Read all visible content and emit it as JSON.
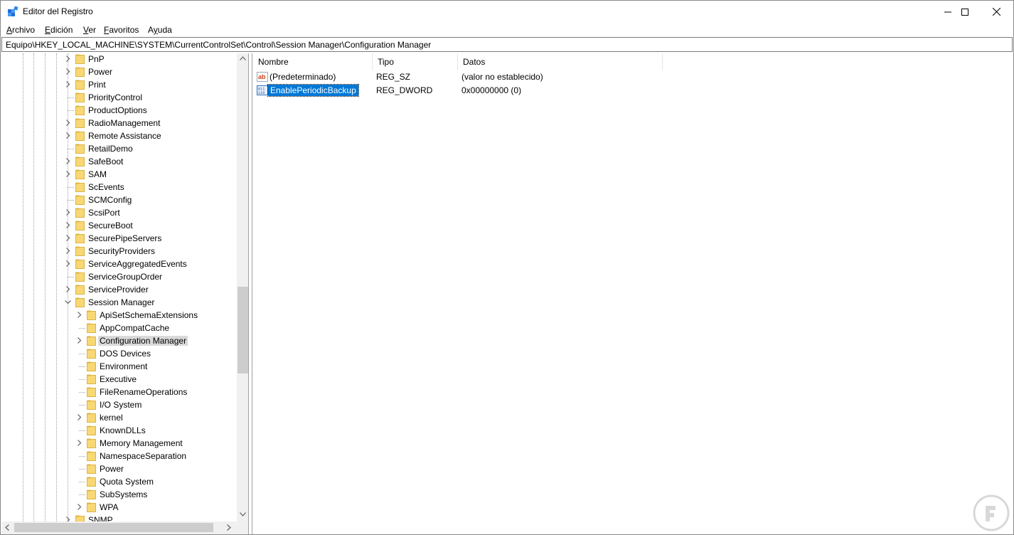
{
  "window": {
    "title": "Editor del Registro",
    "controls": {
      "minimize": "minimize-icon",
      "maximize": "maximize-icon",
      "close": "close-icon"
    }
  },
  "menu": [
    {
      "label": "Archivo",
      "key": "A"
    },
    {
      "label": "Edición",
      "key": "E"
    },
    {
      "label": "Ver",
      "key": "V"
    },
    {
      "label": "Favoritos",
      "key": "F"
    },
    {
      "label": "Ayuda",
      "key": "y"
    }
  ],
  "address": "Equipo\\HKEY_LOCAL_MACHINE\\SYSTEM\\CurrentControlSet\\Control\\Session Manager\\Configuration Manager",
  "tree": {
    "items": [
      {
        "label": "PnP",
        "level": 1,
        "expandable": true
      },
      {
        "label": "Power",
        "level": 1,
        "expandable": true
      },
      {
        "label": "Print",
        "level": 1,
        "expandable": true
      },
      {
        "label": "PriorityControl",
        "level": 1,
        "expandable": false
      },
      {
        "label": "ProductOptions",
        "level": 1,
        "expandable": false
      },
      {
        "label": "RadioManagement",
        "level": 1,
        "expandable": true
      },
      {
        "label": "Remote Assistance",
        "level": 1,
        "expandable": true
      },
      {
        "label": "RetailDemo",
        "level": 1,
        "expandable": false
      },
      {
        "label": "SafeBoot",
        "level": 1,
        "expandable": true
      },
      {
        "label": "SAM",
        "level": 1,
        "expandable": true
      },
      {
        "label": "ScEvents",
        "level": 1,
        "expandable": false
      },
      {
        "label": "SCMConfig",
        "level": 1,
        "expandable": false
      },
      {
        "label": "ScsiPort",
        "level": 1,
        "expandable": true
      },
      {
        "label": "SecureBoot",
        "level": 1,
        "expandable": true
      },
      {
        "label": "SecurePipeServers",
        "level": 1,
        "expandable": true
      },
      {
        "label": "SecurityProviders",
        "level": 1,
        "expandable": true
      },
      {
        "label": "ServiceAggregatedEvents",
        "level": 1,
        "expandable": true
      },
      {
        "label": "ServiceGroupOrder",
        "level": 1,
        "expandable": false
      },
      {
        "label": "ServiceProvider",
        "level": 1,
        "expandable": true
      },
      {
        "label": "Session Manager",
        "level": 1,
        "expandable": true,
        "expanded": true
      },
      {
        "label": "ApiSetSchemaExtensions",
        "level": 2,
        "expandable": true
      },
      {
        "label": "AppCompatCache",
        "level": 2,
        "expandable": false
      },
      {
        "label": "Configuration Manager",
        "level": 2,
        "expandable": true,
        "selected": true
      },
      {
        "label": "DOS Devices",
        "level": 2,
        "expandable": false
      },
      {
        "label": "Environment",
        "level": 2,
        "expandable": false
      },
      {
        "label": "Executive",
        "level": 2,
        "expandable": false
      },
      {
        "label": "FileRenameOperations",
        "level": 2,
        "expandable": false
      },
      {
        "label": "I/O System",
        "level": 2,
        "expandable": false
      },
      {
        "label": "kernel",
        "level": 2,
        "expandable": true
      },
      {
        "label": "KnownDLLs",
        "level": 2,
        "expandable": false
      },
      {
        "label": "Memory Management",
        "level": 2,
        "expandable": true
      },
      {
        "label": "NamespaceSeparation",
        "level": 2,
        "expandable": false
      },
      {
        "label": "Power",
        "level": 2,
        "expandable": false
      },
      {
        "label": "Quota System",
        "level": 2,
        "expandable": false
      },
      {
        "label": "SubSystems",
        "level": 2,
        "expandable": false
      },
      {
        "label": "WPA",
        "level": 2,
        "expandable": true
      },
      {
        "label": "SNMP",
        "level": 1,
        "expandable": true
      }
    ]
  },
  "list": {
    "columns": [
      "Nombre",
      "Tipo",
      "Datos"
    ],
    "rows": [
      {
        "name": "(Predeterminado)",
        "type": "REG_SZ",
        "data": "(valor no establecido)",
        "icon": "string-value-icon",
        "selected": false
      },
      {
        "name": "EnablePeriodicBackup",
        "type": "REG_DWORD",
        "data": "0x00000000 (0)",
        "icon": "binary-value-icon",
        "selected": true
      }
    ]
  },
  "colors": {
    "selection": "#0078d7",
    "tree_selection": "#d9d9d9",
    "folder": "#f8d775",
    "folder_edge": "#dcb442"
  }
}
